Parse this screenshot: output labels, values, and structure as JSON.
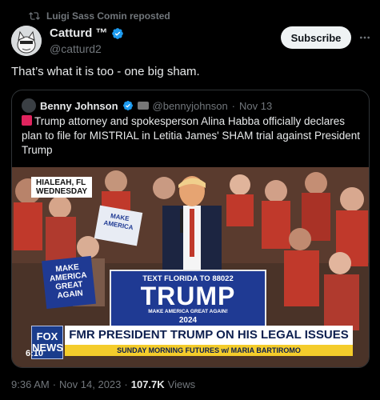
{
  "repost": {
    "text": "Luigi Sass Comin reposted"
  },
  "author": {
    "name": "Catturd ™",
    "handle": "@catturd2"
  },
  "subscribe": {
    "label": "Subscribe"
  },
  "tweet": {
    "text": "That’s what it is too - one big sham."
  },
  "quote": {
    "name": "Benny Johnson",
    "handle": "@bennyjohnson",
    "separator": "·",
    "date": "Nov 13",
    "text": "Trump attorney and spokesperson Alina Habba officially declares plan to file for MISTRIAL in Letitia James' SHAM trial against President Trump",
    "media": {
      "location_line1": "HIALEAH, FL",
      "location_line2": "WEDNESDAY",
      "sign_top": "TEXT FLORIDA TO 88022",
      "sign_main": "TRUMP",
      "sign_sub": "MAKE AMERICA GREAT AGAIN!",
      "sign_year": "2024",
      "maga_left": "MAKE AMERICA GREAT AGAIN",
      "maga_top": "MAKE AMERICA",
      "network": "FOX NEWS",
      "clock": "6:10",
      "headline": "FMR PRESIDENT TRUMP ON HIS LEGAL ISSUES",
      "show": "SUNDAY MORNING FUTURES  w/ MARIA BARTIROMO"
    }
  },
  "footer": {
    "time": "9:36 AM",
    "separator": "·",
    "date": "Nov 14, 2023",
    "separator2": "·",
    "views_count": "107.7K",
    "views_label": "Views"
  },
  "colors": {
    "background": "#000000",
    "verified": "#1d9bf0",
    "muted": "#71767b"
  }
}
